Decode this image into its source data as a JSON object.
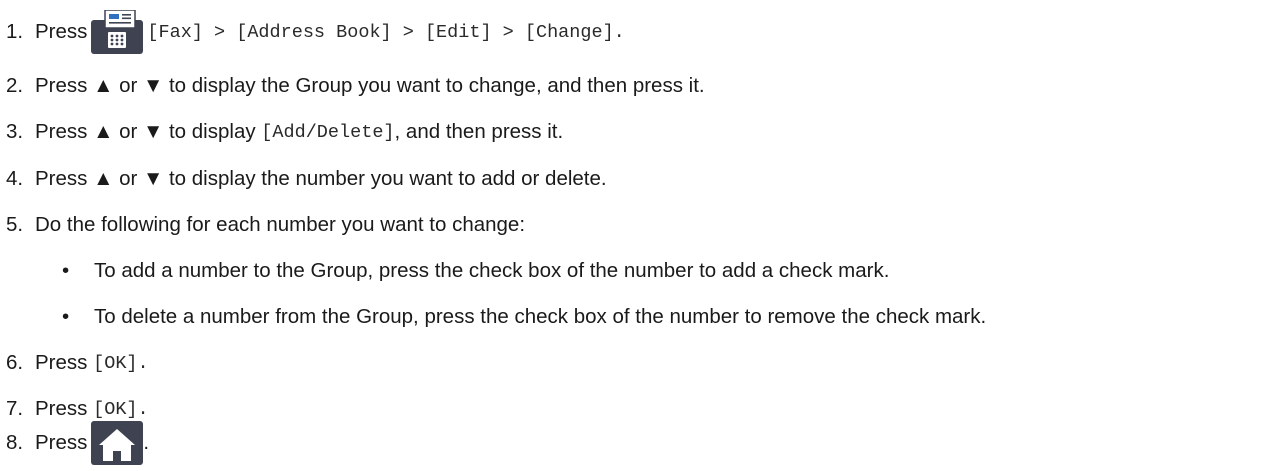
{
  "steps": [
    {
      "number": "1.",
      "press": "Press",
      "icon": "fax-icon",
      "path": "[Fax] > [Address Book] > [Edit] > [Change]."
    },
    {
      "number": "2.",
      "text": "Press ▲ or ▼ to display the Group you want to change, and then press it."
    },
    {
      "number": "3.",
      "text_before": "Press ▲ or ▼ to display ",
      "code": "[Add/Delete]",
      "text_after": ", and then press it."
    },
    {
      "number": "4.",
      "text": "Press ▲ or ▼ to display the number you want to add or delete."
    },
    {
      "number": "5.",
      "text": "Do the following for each number you want to change:",
      "bullets": [
        "To add a number to the Group, press the check box of the number to add a check mark.",
        "To delete a number from the Group, press the check box of the number to remove the check mark."
      ]
    },
    {
      "number": "6.",
      "press": "Press",
      "code": "[OK]."
    },
    {
      "number": "7.",
      "press": "Press",
      "code": "[OK]."
    },
    {
      "number": "8.",
      "press": "Press",
      "icon": "home-icon",
      "end": "."
    }
  ],
  "bullet_char": "•",
  "colors": {
    "icon_dark": "#3e4251",
    "icon_blue": "#2f6fc0",
    "text": "#1a1a1a"
  }
}
